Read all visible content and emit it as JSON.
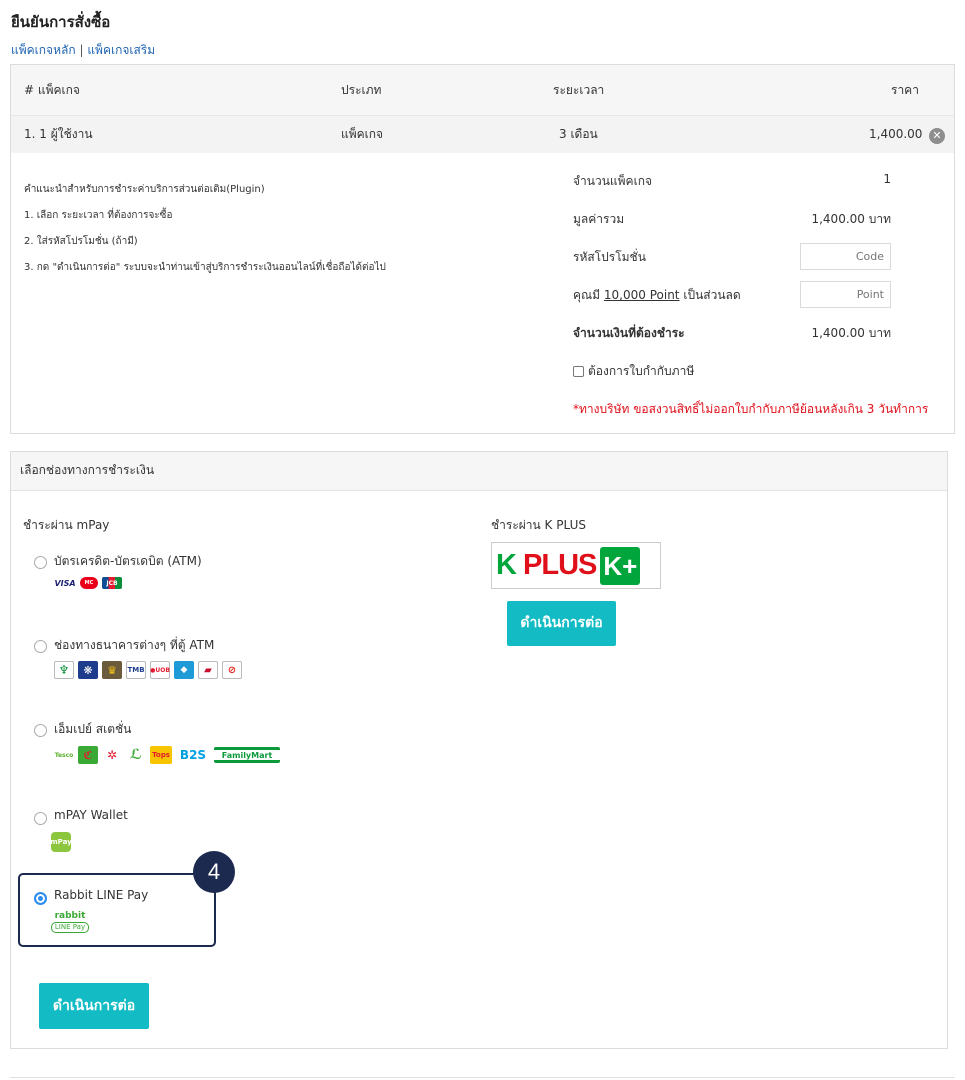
{
  "page": {
    "title": "ยืนยันการสั่งซื้อ",
    "link_main": "แพ็คเกจหลัก",
    "link_sep": "|",
    "link_addon": "แพ็คเกจเสริม"
  },
  "table": {
    "headers": [
      "# แพ็คเกจ",
      "ประเภท",
      "ระยะเวลา",
      "ราคา"
    ],
    "row": {
      "name": "1. 1 ผู้ใช้งาน",
      "type": "แพ็คเกจ",
      "duration": "3 เดือน",
      "price": "1,400.00",
      "remove_icon": "close-icon"
    }
  },
  "instructions": {
    "heading": "คำแนะนำสำหรับการชำระค่าบริการส่วนต่อเติม(Plugin)",
    "steps": [
      "1. เลือก ระยะเวลา ที่ต้องการจะซื้อ",
      "2. ใส่รหัสโปรโมชั่น (ถ้ามี)",
      "3. กด \"ดำเนินการต่อ\" ระบบจะนำท่านเข้าสู่บริการชำระเงินออนไลน์ที่เชื่อถือได้ต่อไป"
    ]
  },
  "summary": {
    "qty_label": "จำนวนแพ็คเกจ",
    "qty_value": "1",
    "total_label": "มูลค่ารวม",
    "total_value": "1,400.00 บาท",
    "promo_label": "รหัสโปรโมชั่น",
    "promo_placeholder": "Code",
    "points_prefix": "คุณมี",
    "points_amount": "10,000 Point",
    "points_suffix": "เป็นส่วนลด",
    "points_placeholder": "Point",
    "pay_label": "จำนวนเงินที่ต้องชำระ",
    "pay_value": "1,400.00 บาท",
    "tax_checkbox_label": "ต้องการใบกำกับภาษี",
    "tax_warning": "*ทางบริษัท ขอสงวนสิทธิ์ไม่ออกใบกำกับภาษีย้อนหลังเกิน 3 วันทำการ"
  },
  "payment": {
    "section_title": "เลือกช่องทางการชำระเงิน",
    "mpay_title": "ชำระผ่าน mPay",
    "kplus_title": "ชำระผ่าน K PLUS",
    "kplus_logo_word1": "K",
    "kplus_logo_word2": "PLUS",
    "kplus_badge": "K+",
    "options": [
      {
        "label": "บัตรเครดิต-บัตรเดบิต (ATM)",
        "selected": false,
        "logos": [
          "VISA",
          "MC",
          "JCB"
        ]
      },
      {
        "label": "ช่องทางธนาคารต่างๆ ที่ตู้ ATM",
        "selected": false,
        "logos": [
          "KBANK",
          "BBL",
          "KTB",
          "TMB",
          "UOB",
          "SCB",
          "BAY",
          "TBANK"
        ]
      },
      {
        "label": "เอ็มเปย์ สเตชั่น",
        "selected": false,
        "logos": [
          "Tesco",
          "Lotus",
          "Cup",
          "Big",
          "Tops",
          "B2S",
          "FamilyMart"
        ]
      },
      {
        "label": "mPAY Wallet",
        "selected": false,
        "logos": [
          "mPay"
        ]
      },
      {
        "label": "Rabbit LINE Pay",
        "selected": true,
        "logos": [
          "rabbit",
          "LINE Pay"
        ]
      }
    ],
    "continue_label": "ดำเนินการต่อ",
    "kplus_continue_label": "ดำเนินการต่อ",
    "step_badge": "4"
  },
  "colors": {
    "accent": "#13bcc4",
    "link": "#1f64b0",
    "warning": "#e0101a",
    "highlight": "#1c2a4f",
    "kplus_green": "#00a63c"
  }
}
